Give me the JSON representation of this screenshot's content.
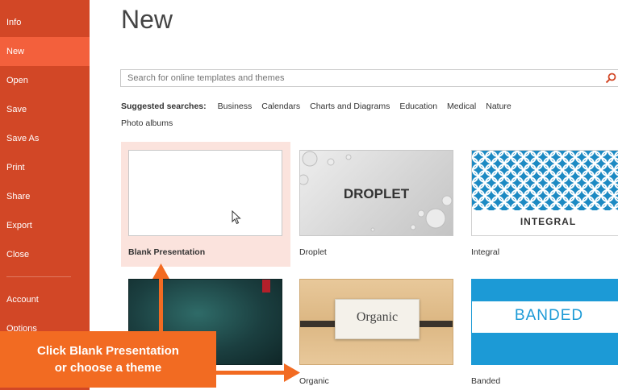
{
  "sidebar": {
    "items": [
      {
        "label": "Info",
        "active": false
      },
      {
        "label": "New",
        "active": true
      },
      {
        "label": "Open",
        "active": false
      },
      {
        "label": "Save",
        "active": false
      },
      {
        "label": "Save As",
        "active": false
      },
      {
        "label": "Print",
        "active": false
      },
      {
        "label": "Share",
        "active": false
      },
      {
        "label": "Export",
        "active": false
      },
      {
        "label": "Close",
        "active": false
      },
      {
        "label": "Account",
        "active": false
      },
      {
        "label": "Options",
        "active": false
      }
    ],
    "color": "#d24726",
    "active_color": "#f3603c"
  },
  "page": {
    "title": "New"
  },
  "search": {
    "placeholder": "Search for online templates and themes"
  },
  "suggested": {
    "label": "Suggested searches:",
    "items": [
      "Business",
      "Calendars",
      "Charts and Diagrams",
      "Education",
      "Medical",
      "Nature",
      "Photo albums"
    ]
  },
  "templates": [
    {
      "name": "Blank Presentation",
      "thumb_text": ""
    },
    {
      "name": "Droplet",
      "thumb_text": "DROPLET"
    },
    {
      "name": "Integral",
      "thumb_text": "INTEGRAL"
    },
    {
      "name": "",
      "thumb_text": ""
    },
    {
      "name": "Organic",
      "thumb_text": "Organic"
    },
    {
      "name": "Banded",
      "thumb_text": "BANDED"
    }
  ],
  "callout": {
    "line1": "Click Blank Presentation",
    "line2": "or choose a theme",
    "color": "#f26b22"
  }
}
